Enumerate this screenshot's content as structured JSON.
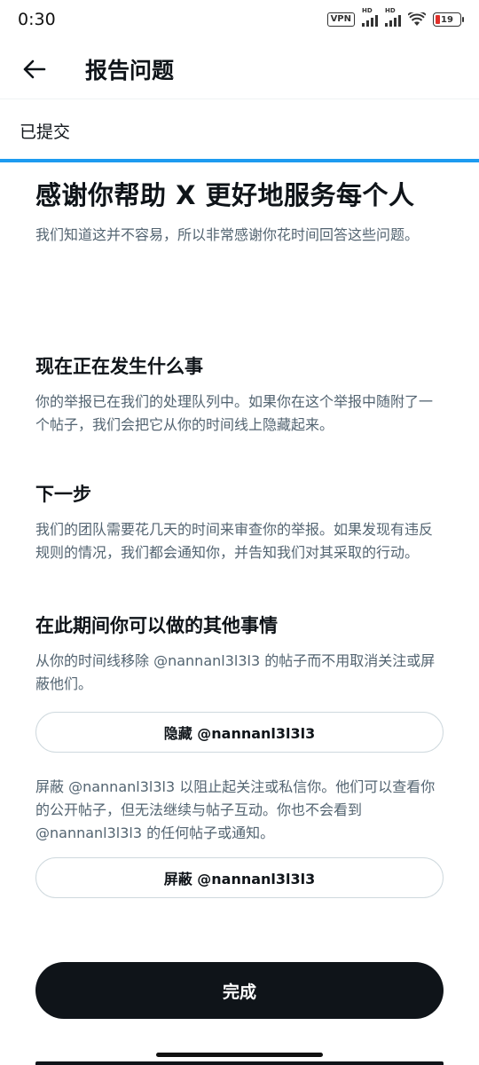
{
  "status_bar": {
    "time": "0:30",
    "vpn": "VPN",
    "signal_label": "HD",
    "battery": "19",
    "battery_color": "#e0302a"
  },
  "header": {
    "back_icon": "arrow-left-icon",
    "title": "报告问题"
  },
  "step": {
    "label": "已提交",
    "progress_color": "#1d9bf0"
  },
  "main": {
    "title": "感谢你帮助 X 更好地服务每个人",
    "subtitle": "我们知道这并不容易，所以非常感谢你花时间回答这些问题。"
  },
  "sections": {
    "happening": {
      "title": "现在正在发生什么事",
      "text": "你的举报已在我们的处理队列中。如果你在这个举报中随附了一个帖子，我们会把它从你的时间线上隐藏起来。"
    },
    "next": {
      "title": "下一步",
      "text": "我们的团队需要花几天的时间来审查你的举报。如果发现有违反规则的情况，我们都会通知你，并告知我们对其采取的行动。"
    },
    "other": {
      "title": "在此期间你可以做的其他事情",
      "hide_text": "从你的时间线移除 @nannanl3l3l3 的帖子而不用取消关注或屏蔽他们。",
      "hide_button": "隐藏 @nannanl3l3l3",
      "block_text": "屏蔽 @nannanl3l3l3 以阻止起关注或私信你。他们可以查看你的公开帖子，但无法继续与帖子互动。你也不会看到 @nannanl3l3l3 的任何帖子或通知。",
      "block_button": "屏蔽 @nannanl3l3l3"
    }
  },
  "footer": {
    "done_button": "完成"
  }
}
